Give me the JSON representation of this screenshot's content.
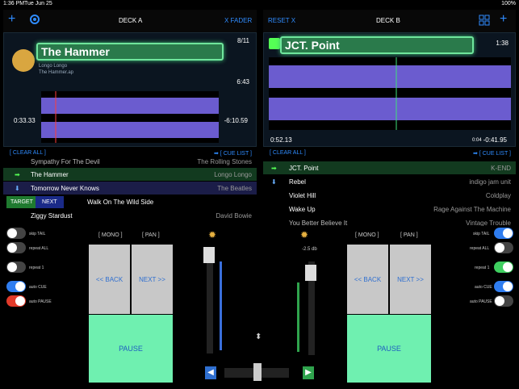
{
  "status": {
    "time": "1:36 PM",
    "date": "Tue Jun 25",
    "battery": "100%"
  },
  "header": {
    "deck_a": "DECK A",
    "x_fader": "X FADER",
    "reset_x": "RESET X",
    "deck_b": "DECK B"
  },
  "deckA": {
    "title": "The Hammer",
    "artist": "Longo Longo",
    "file": "The Hammer.ap",
    "count": "8/11",
    "duration": "6:43",
    "elapsed": "0:33.33",
    "remaining": "-6:10.59"
  },
  "deckB": {
    "title": "JCT. Point",
    "duration": "1:38",
    "elapsed": "0:52.13",
    "cue": "0:04",
    "remaining": "-0:41.95"
  },
  "listA": {
    "clear": "[ CLEAR ALL ]",
    "cue": "➡ [ CUE LIST ]",
    "rows": [
      {
        "title": "Sympathy For The Devil",
        "artist": "The Rolling Stones"
      },
      {
        "title": "The Hammer",
        "artist": "Longo Longo"
      },
      {
        "title": "Tomorrow Never Knows",
        "artist": "The Beatles"
      },
      {
        "title": "Walk On The Wild Side",
        "artist": ""
      },
      {
        "title": "Ziggy Stardust",
        "artist": "David Bowie"
      }
    ],
    "target": "TARGET",
    "next": "NEXT"
  },
  "listB": {
    "clear": "[ CLEAR ALL ]",
    "cue": "➡ [ CUE LIST ]",
    "rows": [
      {
        "title": "JCT. Point",
        "artist": "K-END"
      },
      {
        "title": "Rebel",
        "artist": "indigo jam unit"
      },
      {
        "title": "Violet Hill",
        "artist": "Coldplay"
      },
      {
        "title": "Wake Up",
        "artist": "Rage Against The Machine"
      },
      {
        "title": "You Better Believe It",
        "artist": "Vintage Trouble"
      }
    ]
  },
  "controlsA": {
    "skip": "skip TAIL",
    "repeat_all": "repeat ALL",
    "repeat1": "repeat 1",
    "auto_cue": "auto CUE",
    "auto_pause": "auto PAUSE"
  },
  "controlsB": {
    "skip": "skip TAIL",
    "repeat_all": "repeat ALL",
    "repeat1": "repeat 1",
    "auto_cue": "auto CUE",
    "auto_pause": "auto PAUSE"
  },
  "padsA": {
    "mono": "[ MONO ]",
    "pan": "[ PAN ]",
    "back": "<< BACK",
    "next": "NEXT >>",
    "pause": "PAUSE"
  },
  "padsB": {
    "mono": "[ MONO ]",
    "pan": "[ PAN ]",
    "back": "<< BACK",
    "next": "NEXT >>",
    "pause": "PAUSE"
  },
  "mixer": {
    "db": "-2.5 db"
  }
}
